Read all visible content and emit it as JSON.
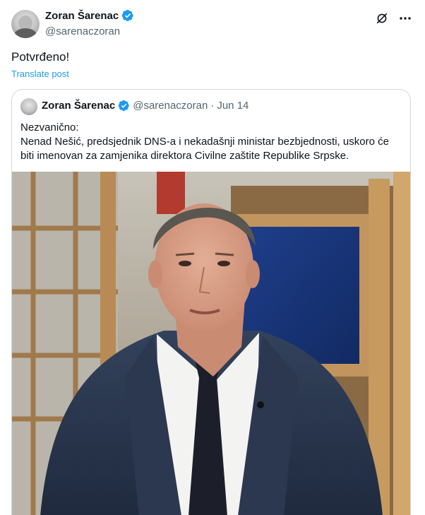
{
  "post": {
    "author_name": "Zoran Šarenac",
    "handle": "@sarenaczoran",
    "text": "Potvrđeno!",
    "translate_label": "Translate post"
  },
  "quote": {
    "author_name": "Zoran Šarenac",
    "handle": "@sarenaczoran",
    "separator": "·",
    "date": "Jun 14",
    "lines": [
      "Nezvanično:",
      "Nenad Nešić, predsjednik DNS-a i nekadašnji ministar bezbjednosti, uskoro će",
      "biti imenovan za zamjenika direktora Civilne zaštite Republike Srpske."
    ]
  },
  "colors": {
    "accent": "#1d9bf0",
    "text": "#0f1419",
    "secondary": "#536471",
    "border": "#cfd9de"
  },
  "icons": {
    "verified": "verified-badge-icon",
    "grok": "grok-icon",
    "more": "more-icon"
  }
}
